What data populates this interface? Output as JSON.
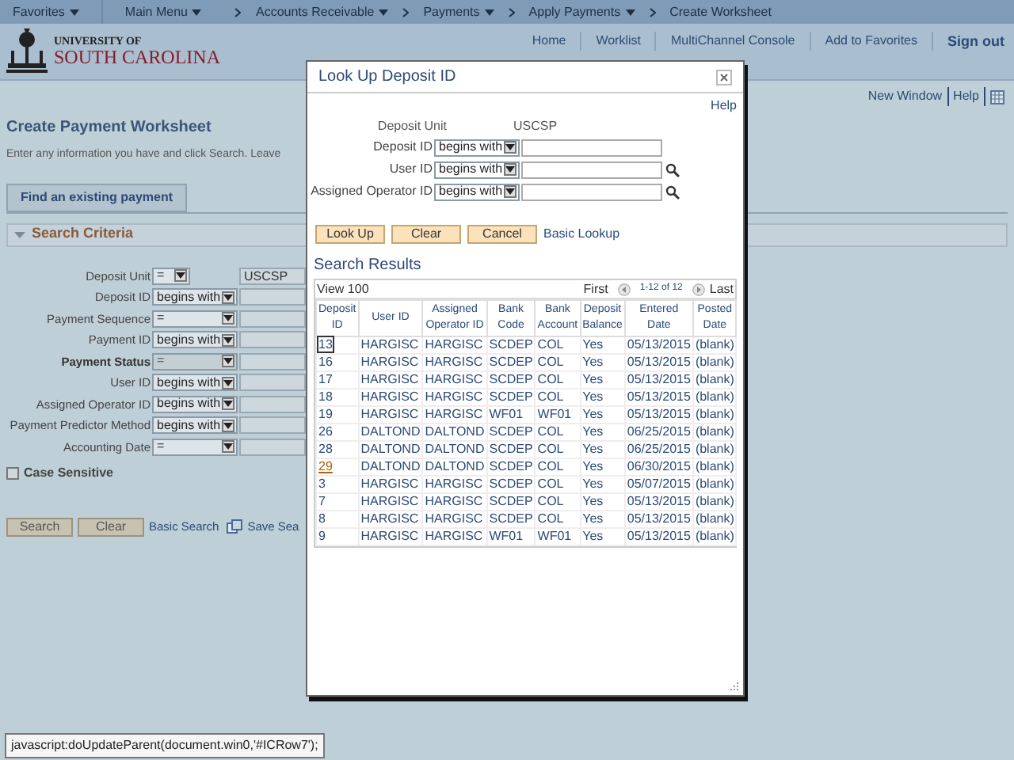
{
  "nav_bar": {
    "items": [
      {
        "label": "Favorites",
        "menu": true
      },
      {
        "label": "Main Menu",
        "menu": true
      },
      {
        "label": "Accounts Receivable",
        "menu": true
      },
      {
        "label": "Payments",
        "menu": true
      },
      {
        "label": "Apply Payments",
        "menu": true
      },
      {
        "label": "Create Worksheet",
        "menu": false
      }
    ]
  },
  "header": {
    "logo": {
      "line_1": "UNIVERSITY OF",
      "line_2": "SOUTH CAROLINA"
    },
    "links": [
      "Home",
      "Worklist",
      "MultiChannel Console",
      "Add to Favorites",
      "Sign out"
    ]
  },
  "page": {
    "toolbar_links": [
      "New Window",
      "Help"
    ],
    "title": "Create Payment Worksheet",
    "instructions": "Enter any information you have and click Search. Leave",
    "tab": "Find an existing payment",
    "section": {
      "title": "Search Criteria",
      "expanded": true
    },
    "criteria": [
      {
        "label": "Deposit Unit",
        "operator": "=",
        "value": "USCSP",
        "bold": false,
        "disabled": false
      },
      {
        "label": "Deposit ID",
        "operator": "begins with",
        "bold": false,
        "disabled": false
      },
      {
        "label": "Payment Sequence",
        "operator": "=",
        "bold": false,
        "disabled": false
      },
      {
        "label": "Payment ID",
        "operator": "begins with",
        "bold": false,
        "disabled": false
      },
      {
        "label": "Payment Status",
        "operator": "=",
        "bold": true,
        "disabled": true
      },
      {
        "label": "User ID",
        "operator": "begins with",
        "bold": false,
        "disabled": false
      },
      {
        "label": "Assigned Operator ID",
        "operator": "begins with",
        "bold": false,
        "disabled": false
      },
      {
        "label": "Payment Predictor Method",
        "operator": "begins with",
        "bold": false,
        "disabled": false
      },
      {
        "label": "Accounting Date",
        "operator": "=",
        "bold": false,
        "disabled": false
      }
    ],
    "case_sensitive": {
      "label": "Case Sensitive",
      "checked": false
    },
    "buttons": [
      "Search",
      "Clear"
    ],
    "links": [
      "Basic Search",
      "Save Sea"
    ]
  },
  "dialog": {
    "title": "Look Up Deposit ID",
    "help": "Help",
    "deposit_unit": {
      "label": "Deposit Unit",
      "value": "USCSP"
    },
    "criteria": [
      {
        "label": "Deposit ID",
        "operator": "begins with",
        "lookup": false
      },
      {
        "label": "User ID",
        "operator": "begins with",
        "lookup": true
      },
      {
        "label": "Assigned Operator ID",
        "operator": "begins with",
        "lookup": true
      }
    ],
    "buttons": [
      "Look Up",
      "Clear",
      "Cancel"
    ],
    "link": "Basic Lookup",
    "results_title": "Search Results",
    "grid": {
      "view": "View 100",
      "first": "First",
      "range": "1-12 of 12",
      "last": "Last",
      "columns": [
        "Deposit ID",
        "User ID",
        "Assigned Operator ID",
        "Bank Code",
        "Bank Account",
        "Deposit Balance",
        "Entered Date",
        "Posted Date"
      ],
      "rows": [
        {
          "cells": [
            "13",
            "HARGISC",
            "HARGISC",
            "SCDEP",
            "COL",
            "Yes",
            "05/13/2015",
            "(blank)"
          ],
          "focused": true,
          "hovered": false
        },
        {
          "cells": [
            "16",
            "HARGISC",
            "HARGISC",
            "SCDEP",
            "COL",
            "Yes",
            "05/13/2015",
            "(blank)"
          ],
          "focused": false,
          "hovered": false
        },
        {
          "cells": [
            "17",
            "HARGISC",
            "HARGISC",
            "SCDEP",
            "COL",
            "Yes",
            "05/13/2015",
            "(blank)"
          ],
          "focused": false,
          "hovered": false
        },
        {
          "cells": [
            "18",
            "HARGISC",
            "HARGISC",
            "SCDEP",
            "COL",
            "Yes",
            "05/13/2015",
            "(blank)"
          ],
          "focused": false,
          "hovered": false
        },
        {
          "cells": [
            "19",
            "HARGISC",
            "HARGISC",
            "WF01",
            "WF01",
            "Yes",
            "05/13/2015",
            "(blank)"
          ],
          "focused": false,
          "hovered": false
        },
        {
          "cells": [
            "26",
            "DALTOND",
            "DALTOND",
            "SCDEP",
            "COL",
            "Yes",
            "06/25/2015",
            "(blank)"
          ],
          "focused": false,
          "hovered": false
        },
        {
          "cells": [
            "28",
            "DALTOND",
            "DALTOND",
            "SCDEP",
            "COL",
            "Yes",
            "06/25/2015",
            "(blank)"
          ],
          "focused": false,
          "hovered": false
        },
        {
          "cells": [
            "29",
            "DALTOND",
            "DALTOND",
            "SCDEP",
            "COL",
            "Yes",
            "06/30/2015",
            "(blank)"
          ],
          "focused": false,
          "hovered": true
        },
        {
          "cells": [
            "3",
            "HARGISC",
            "HARGISC",
            "SCDEP",
            "COL",
            "Yes",
            "05/07/2015",
            "(blank)"
          ],
          "focused": false,
          "hovered": false
        },
        {
          "cells": [
            "7",
            "HARGISC",
            "HARGISC",
            "SCDEP",
            "COL",
            "Yes",
            "05/13/2015",
            "(blank)"
          ],
          "focused": false,
          "hovered": false
        },
        {
          "cells": [
            "8",
            "HARGISC",
            "HARGISC",
            "SCDEP",
            "COL",
            "Yes",
            "05/13/2015",
            "(blank)"
          ],
          "focused": false,
          "hovered": false
        },
        {
          "cells": [
            "9",
            "HARGISC",
            "HARGISC",
            "WF01",
            "WF01",
            "Yes",
            "05/13/2015",
            "(blank)"
          ],
          "focused": false,
          "hovered": false
        }
      ]
    }
  },
  "status_tooltip": "javascript:doUpdateParent(document.win0,'#ICRow7');"
}
